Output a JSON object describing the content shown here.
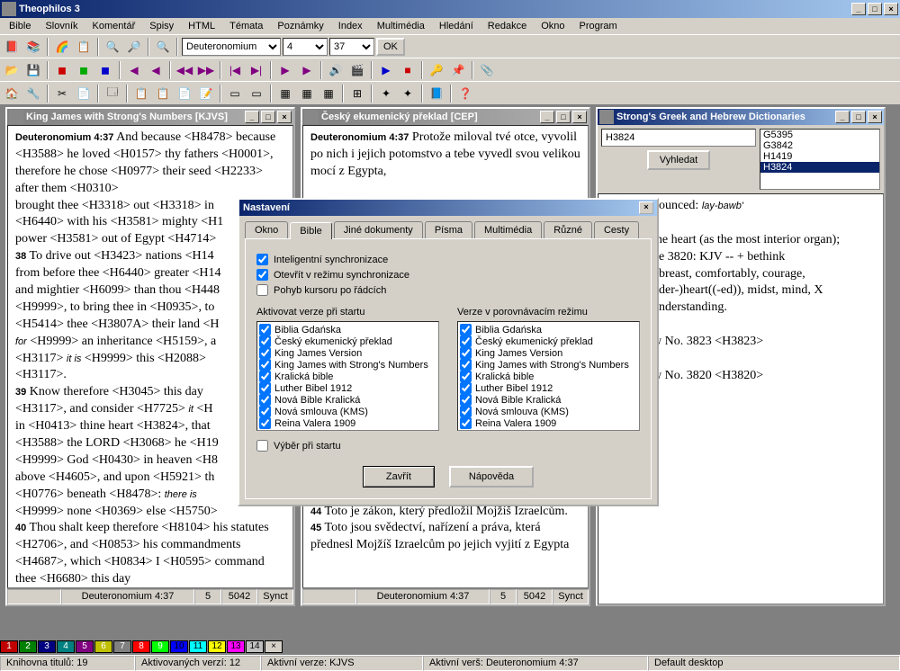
{
  "app": {
    "title": "Theophilos 3"
  },
  "menubar": [
    "Bible",
    "Slovník",
    "Komentář",
    "Spisy",
    "HTML",
    "Témata",
    "Poznámky",
    "Index",
    "Multimédia",
    "Hledání",
    "Redakce",
    "Okno",
    "Program"
  ],
  "nav": {
    "book": "Deuteronomium",
    "chapter": "4",
    "verse": "37",
    "ok": "OK"
  },
  "windows": {
    "kjvs": {
      "title": "King James with Strong's Numbers [KJVS]",
      "body_html": "<span class='verse-ref'>Deuteronomium 4:37</span>  And because &lt;H8478&gt; because &lt;H3588&gt; he loved &lt;H0157&gt; thy fathers &lt;H0001&gt;, therefore he chose &lt;H0977&gt; their seed &lt;H2233&gt; after them &lt;H0310&gt;<br>brought thee &lt;H3318&gt; out &lt;H3318&gt; in<br>&lt;H6440&gt; with his &lt;H3581&gt; mighty &lt;H1<br>power &lt;H3581&gt; out of Egypt &lt;H4714&gt;<br><b>38</b>  To drive out &lt;H3423&gt; nations &lt;H14<br>from before thee &lt;H6440&gt; greater &lt;H14<br>and mightier &lt;H6099&gt; than thou &lt;H448<br>&lt;H9999&gt;, to bring thee in &lt;H0935&gt;, to<br>&lt;H5414&gt; thee &lt;H3807A&gt; their land &lt;H<br><i>for</i> &lt;H9999&gt; an inheritance &lt;H5159&gt;, a<br>&lt;H3117&gt; <i>it is</i> &lt;H9999&gt; this &lt;H2088&gt;<br>&lt;H3117&gt;.<br><b>39</b>  Know therefore &lt;H3045&gt; this day<br>&lt;H3117&gt;, and consider &lt;H7725&gt; <i>it</i> &lt;H<br>in &lt;H0413&gt; thine heart &lt;H3824&gt;, that<br>&lt;H3588&gt; the LORD &lt;H3068&gt; he &lt;H19<br>&lt;H9999&gt; God &lt;H0430&gt; in heaven &lt;H8<br>above &lt;H4605&gt;, and upon &lt;H5921&gt; th<br>&lt;H0776&gt; beneath &lt;H8478&gt;: <i>there is</i><br>&lt;H9999&gt; none &lt;H0369&gt; else &lt;H5750&gt;<br><b>40</b>  Thou shalt keep therefore &lt;H8104&gt; his statutes &lt;H2706&gt;, and &lt;H0853&gt; his commandments &lt;H4687&gt;, which &lt;H0834&gt; I &lt;H0595&gt; command thee &lt;H6680&gt; this day",
      "status": {
        "ref": "Deuteronomium 4:37",
        "n1": "5",
        "n2": "5042",
        "sync": "Synct"
      }
    },
    "cep": {
      "title": "Český ekumenický překlad [CEP]",
      "body_html": "<span class='verse-ref'>Deuteronomium 4:37</span>  Protože miloval tvé otce, vyvolil po nich i jejich potomstvo a tebe vyvedl svou velikou mocí z Egypta,<br><br><br><br><br><br><br><br><br><br><br><br><br><br><br><br><br><br><br><br><b>44</b>  Toto je zákon, který předložil Mojžíš Izraelcům.<br><b>45</b>  Toto jsou svědectví, nařízení a práva, která přednesl Mojžíš Izraelcům po jejich vyjití z Egypta",
      "status": {
        "ref": "Deuteronomium 4:37",
        "n1": "5",
        "n2": "5042",
        "sync": "Synct"
      }
    },
    "strongs": {
      "title": "Strong's Greek and Hebrew Dictionaries",
      "search": {
        "input": "H3824",
        "button": "Vyhledat"
      },
      "list": [
        "G5395",
        "G3842",
        "H1419",
        "H3824"
      ],
      "selected": "H3824",
      "body_html": "nounced: <i>lay-bawb'</i><br><br>the heart (as the most interior organ);<br>ke 3820: KJV -- + bethink<br>, breast, comfortably, courage,<br>nder-)heart((-ed)), midst, mind, X<br>understanding.<br><br>w No. 3823 &lt;H3823&gt;<br><br>w No. 3820 &lt;H3820&gt;"
    }
  },
  "modal": {
    "title": "Nastavení",
    "tabs": [
      "Okno",
      "Bible",
      "Jiné dokumenty",
      "Písma",
      "Multimédia",
      "Různé",
      "Cesty"
    ],
    "active_tab": "Bible",
    "checks": {
      "sync": "Inteligentní synchronizace",
      "open_sync": "Otevřít v režimu synchronizace",
      "cursor": "Pohyb kursoru po řádcích",
      "startup_sel": "Výběr při startu"
    },
    "list_labels": {
      "startup": "Aktivovat verze při startu",
      "compare": "Verze v porovnávacím režimu"
    },
    "versions": [
      "Biblia Gdańska",
      "Český ekumenický překlad",
      "King James Version",
      "King James with Strong's Numbers",
      "Kralická bible",
      "Luther Bibel 1912",
      "Nová Bible Kralická",
      "Nová smlouva (KMS)",
      "Reina Valera 1909"
    ],
    "buttons": {
      "close": "Zavřít",
      "help": "Nápověda"
    }
  },
  "desktops": {
    "count": 14
  },
  "desktop_colors": [
    "#c00000",
    "#008000",
    "#000080",
    "#008080",
    "#800080",
    "#c0c000",
    "#808080",
    "#ff0000",
    "#00ff00",
    "#0000ff",
    "#00ffff",
    "#ffff00",
    "#ff00ff",
    "#c0c0c0"
  ],
  "statusbar": {
    "titles": "Knihovna titulů: 19",
    "versions": "Aktivovaných verzí: 12",
    "active_ver": "Aktivní verze: KJVS",
    "active_verse": "Aktivní verš: Deuteronomium 4:37",
    "desktop": "Default desktop"
  }
}
